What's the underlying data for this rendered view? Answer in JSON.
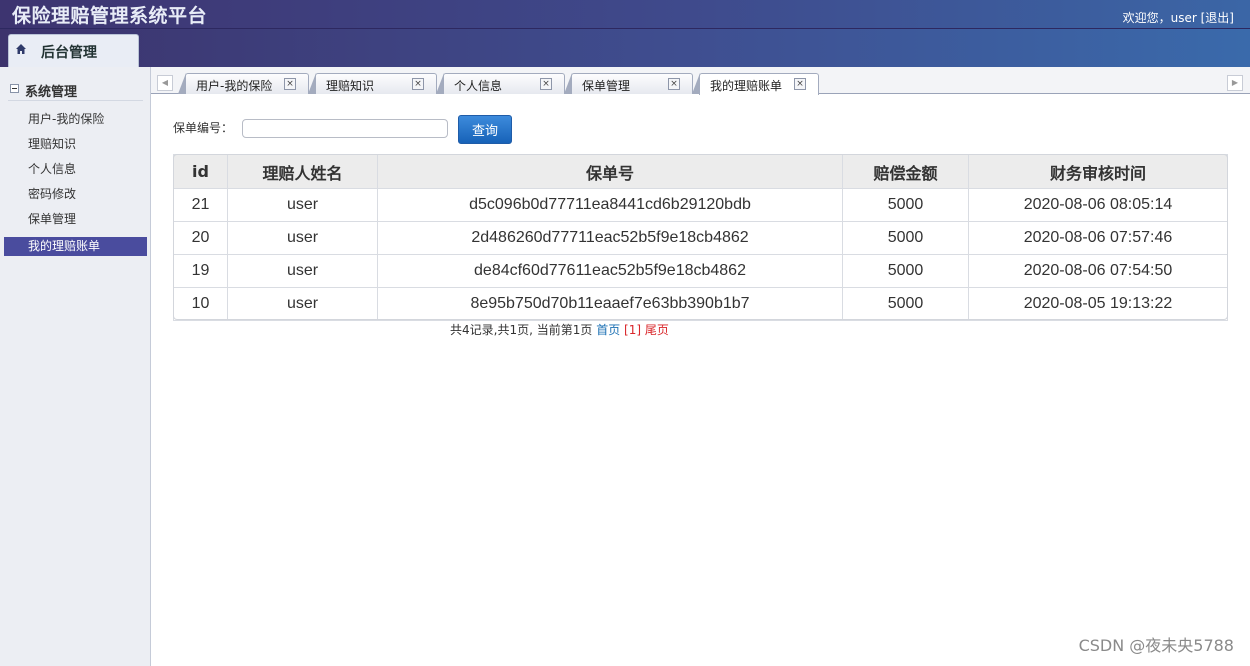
{
  "header": {
    "title": "保险理赔管理系统平台",
    "welcome": "欢迎您，user",
    "logout": "[退出]"
  },
  "admin_tab": {
    "label": "后台管理",
    "icon": "home-icon"
  },
  "sidebar": {
    "group": "系统管理",
    "items": [
      {
        "label": "用户-我的保险"
      },
      {
        "label": "理赔知识"
      },
      {
        "label": "个人信息"
      },
      {
        "label": "密码修改"
      },
      {
        "label": "保单管理"
      },
      {
        "label": "我的理赔账单"
      }
    ],
    "active_index": 5
  },
  "tabs": [
    {
      "label": "用户-我的保险",
      "close": "×"
    },
    {
      "label": "理赔知识",
      "close": "×"
    },
    {
      "label": "个人信息",
      "close": "×"
    },
    {
      "label": "保单管理",
      "close": "×"
    },
    {
      "label": "我的理赔账单",
      "close": "×"
    }
  ],
  "active_tab": 4,
  "search": {
    "label": "保单编号：",
    "value": "",
    "placeholder": "",
    "button": "查询"
  },
  "table": {
    "columns": [
      "id",
      "理赔人姓名",
      "保单号",
      "赔偿金额",
      "财务审核时间"
    ],
    "rows": [
      [
        "21",
        "user",
        "d5c096b0d77711ea8441cd6b29120bdb",
        "5000",
        "2020-08-06 08:05:14"
      ],
      [
        "20",
        "user",
        "2d486260d77711eac52b5f9e18cb4862",
        "5000",
        "2020-08-06 07:57:46"
      ],
      [
        "19",
        "user",
        "de84cf60d77611eac52b5f9e18cb4862",
        "5000",
        "2020-08-06 07:54:50"
      ],
      [
        "10",
        "user",
        "8e95b750d70b11eaaef7e63bb390b1b7",
        "5000",
        "2020-08-05 19:13:22"
      ]
    ]
  },
  "pager": {
    "summary": "共4记录,共1页, 当前第1页",
    "first": "首页",
    "current": "[1]",
    "last": "尾页"
  },
  "watermark": "CSDN @夜未央5788",
  "colors": {
    "header_start": "#3d3470",
    "header_end": "#3b66a6",
    "sidebar_active": "#4a4c9e",
    "button_blue": "#1762b8",
    "pager_link": "#1a6fb3",
    "pager_current": "#d9262a"
  }
}
